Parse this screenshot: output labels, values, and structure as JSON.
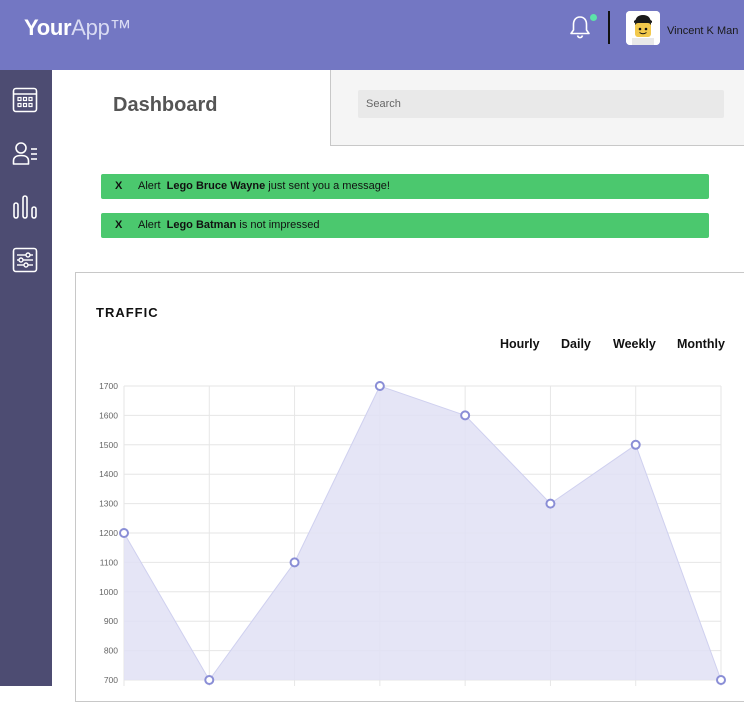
{
  "header": {
    "logo_bold": "Your",
    "logo_light": "App™",
    "user_name": "Vincent K Man",
    "accent_color": "#7377c3",
    "notification_dot_color": "#5ce3a8"
  },
  "sidebar": {
    "background": "#4d4c72",
    "icons": [
      "calendar-grid-icon",
      "users-list-icon",
      "bar-chart-icon",
      "settings-sliders-icon"
    ]
  },
  "page": {
    "title": "Dashboard",
    "search_placeholder": "Search"
  },
  "alerts": [
    {
      "close": "X",
      "label": "Alert",
      "name": "Lego Bruce Wayne",
      "text": " just sent you a message!"
    },
    {
      "close": "X",
      "label": "Alert",
      "name": "Lego Batman",
      "text": " is not impressed"
    }
  ],
  "traffic": {
    "title": "TRAFFIC",
    "tabs": [
      "Hourly",
      "Daily",
      "Weekly",
      "Monthly"
    ]
  },
  "chart_data": {
    "type": "area",
    "title": "",
    "xlabel": "",
    "ylabel": "",
    "x": [
      0,
      1,
      2,
      3,
      4,
      5,
      6,
      7
    ],
    "series": [
      {
        "values": [
          1200,
          700,
          1100,
          1700,
          1600,
          1300,
          1500,
          700
        ],
        "color": "#8a8ed6",
        "fill": "#e1e1f5"
      }
    ],
    "y_ticks": [
      700,
      800,
      900,
      1000,
      1100,
      1200,
      1300,
      1400,
      1500,
      1600,
      1700
    ],
    "ylim": [
      700,
      1700
    ],
    "grid": true,
    "legend": "none"
  }
}
